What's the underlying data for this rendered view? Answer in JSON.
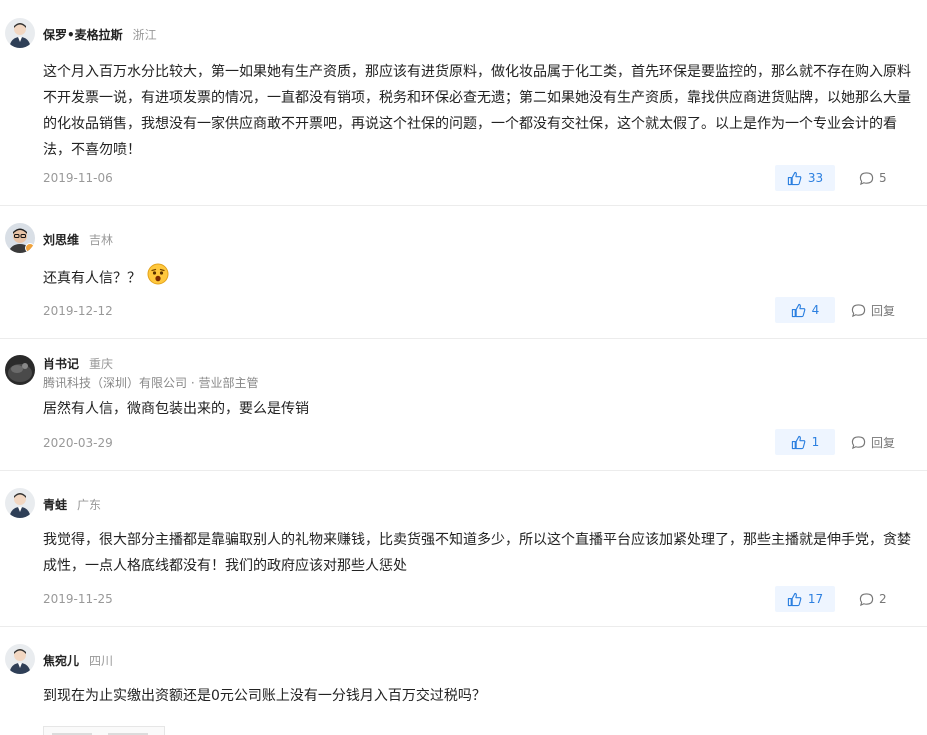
{
  "comments": [
    {
      "name": "保罗•麦格拉斯",
      "region": "浙江",
      "content": "这个月入百万水分比较大，第一如果她有生产资质，那应该有进货原料，做化妆品属于化工类，首先环保是要监控的，那么就不存在购入原料不开发票一说，有进项发票的情况，一直都没有销项，税务和环保必查无遗；第二如果她没有生产资质，靠找供应商进货贴牌，以她那么大量的化妆品销售，我想没有一家供应商敢不开票吧，再说这个社保的问题，一个都没有交社保，这个就太假了。以上是作为一个专业会计的看法，不喜勿喷！",
      "date": "2019-11-06",
      "likes": "33",
      "replies": "5"
    },
    {
      "name": "刘思维",
      "region": "吉林",
      "content": "还真有人信？？",
      "date": "2019-12-12",
      "likes": "4",
      "replies": "回复"
    },
    {
      "name": "肖书记",
      "region": "重庆",
      "company": "腾讯科技（深圳）有限公司 · 营业部主管",
      "content": "居然有人信，微商包装出来的，要么是传销",
      "date": "2020-03-29",
      "likes": "1",
      "replies": "回复"
    },
    {
      "name": "青蛙",
      "region": "广东",
      "content": "我觉得，很大部分主播都是靠骗取别人的礼物来赚钱，比卖货强不知道多少，所以这个直播平台应该加紧处理了，那些主播就是伸手党，贪婪成性，一点人格底线都没有！我们的政府应该对那些人惩处",
      "date": "2019-11-25",
      "likes": "17",
      "replies": "2"
    },
    {
      "name": "焦宛儿",
      "region": "四川",
      "content": "到现在为止实缴出资额还是0元公司账上没有一分钱月入百万交过税吗？"
    }
  ],
  "icons": {
    "like": "thumbs-up-icon",
    "reply": "speech-bubble-icon",
    "emoji": "shocked-face-emoji"
  },
  "colors": {
    "accent": "#2b7fe0",
    "like_bg": "#eef5ff",
    "muted": "#999999"
  }
}
